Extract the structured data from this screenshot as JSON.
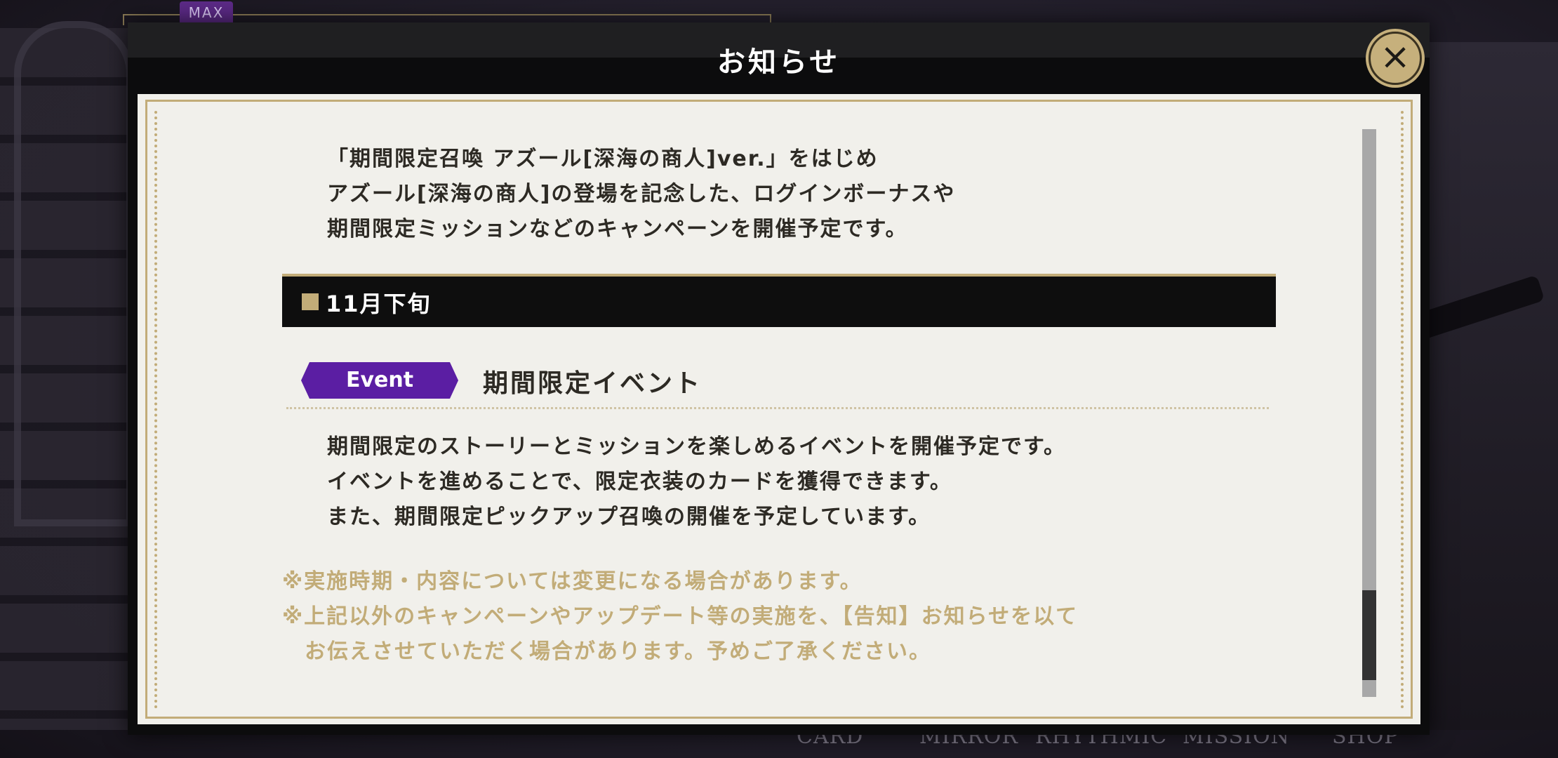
{
  "background": {
    "badge": "MAX",
    "nav": [
      "CARD",
      "MIRROR",
      "RHYTHMIC",
      "MISSION",
      "SHOP"
    ]
  },
  "modal": {
    "title": "お知らせ",
    "close_symbol": "×"
  },
  "intro": {
    "lines": [
      "「期間限定召喚 アズール[深海の商人]ver.」をはじめ",
      "アズール[深海の商人]の登場を記念した、ログインボーナスや",
      "期間限定ミッションなどのキャンペーンを開催予定です。"
    ]
  },
  "section": {
    "heading": "11月下旬"
  },
  "event": {
    "badge": "Event",
    "title": "期間限定イベント",
    "lines": [
      "期間限定のストーリーとミッションを楽しめるイベントを開催予定です。",
      "イベントを進めることで、限定衣装のカードを獲得できます。",
      "また、期間限定ピックアップ召喚の開催を予定しています。"
    ]
  },
  "notes": [
    "※実施時期・内容については変更になる場合があります。",
    "※上記以外のキャンペーンやアップデート等の実施を、【告知】お知らせを以て",
    "　お伝えさせていただく場合があります。予めご了承ください。"
  ],
  "scroll": {
    "position_fraction": 0.93
  },
  "colors": {
    "gold": "#c2ac78",
    "event_purple": "#5b1ea3",
    "paper": "#f1f0eb",
    "text": "#2d2a24"
  }
}
